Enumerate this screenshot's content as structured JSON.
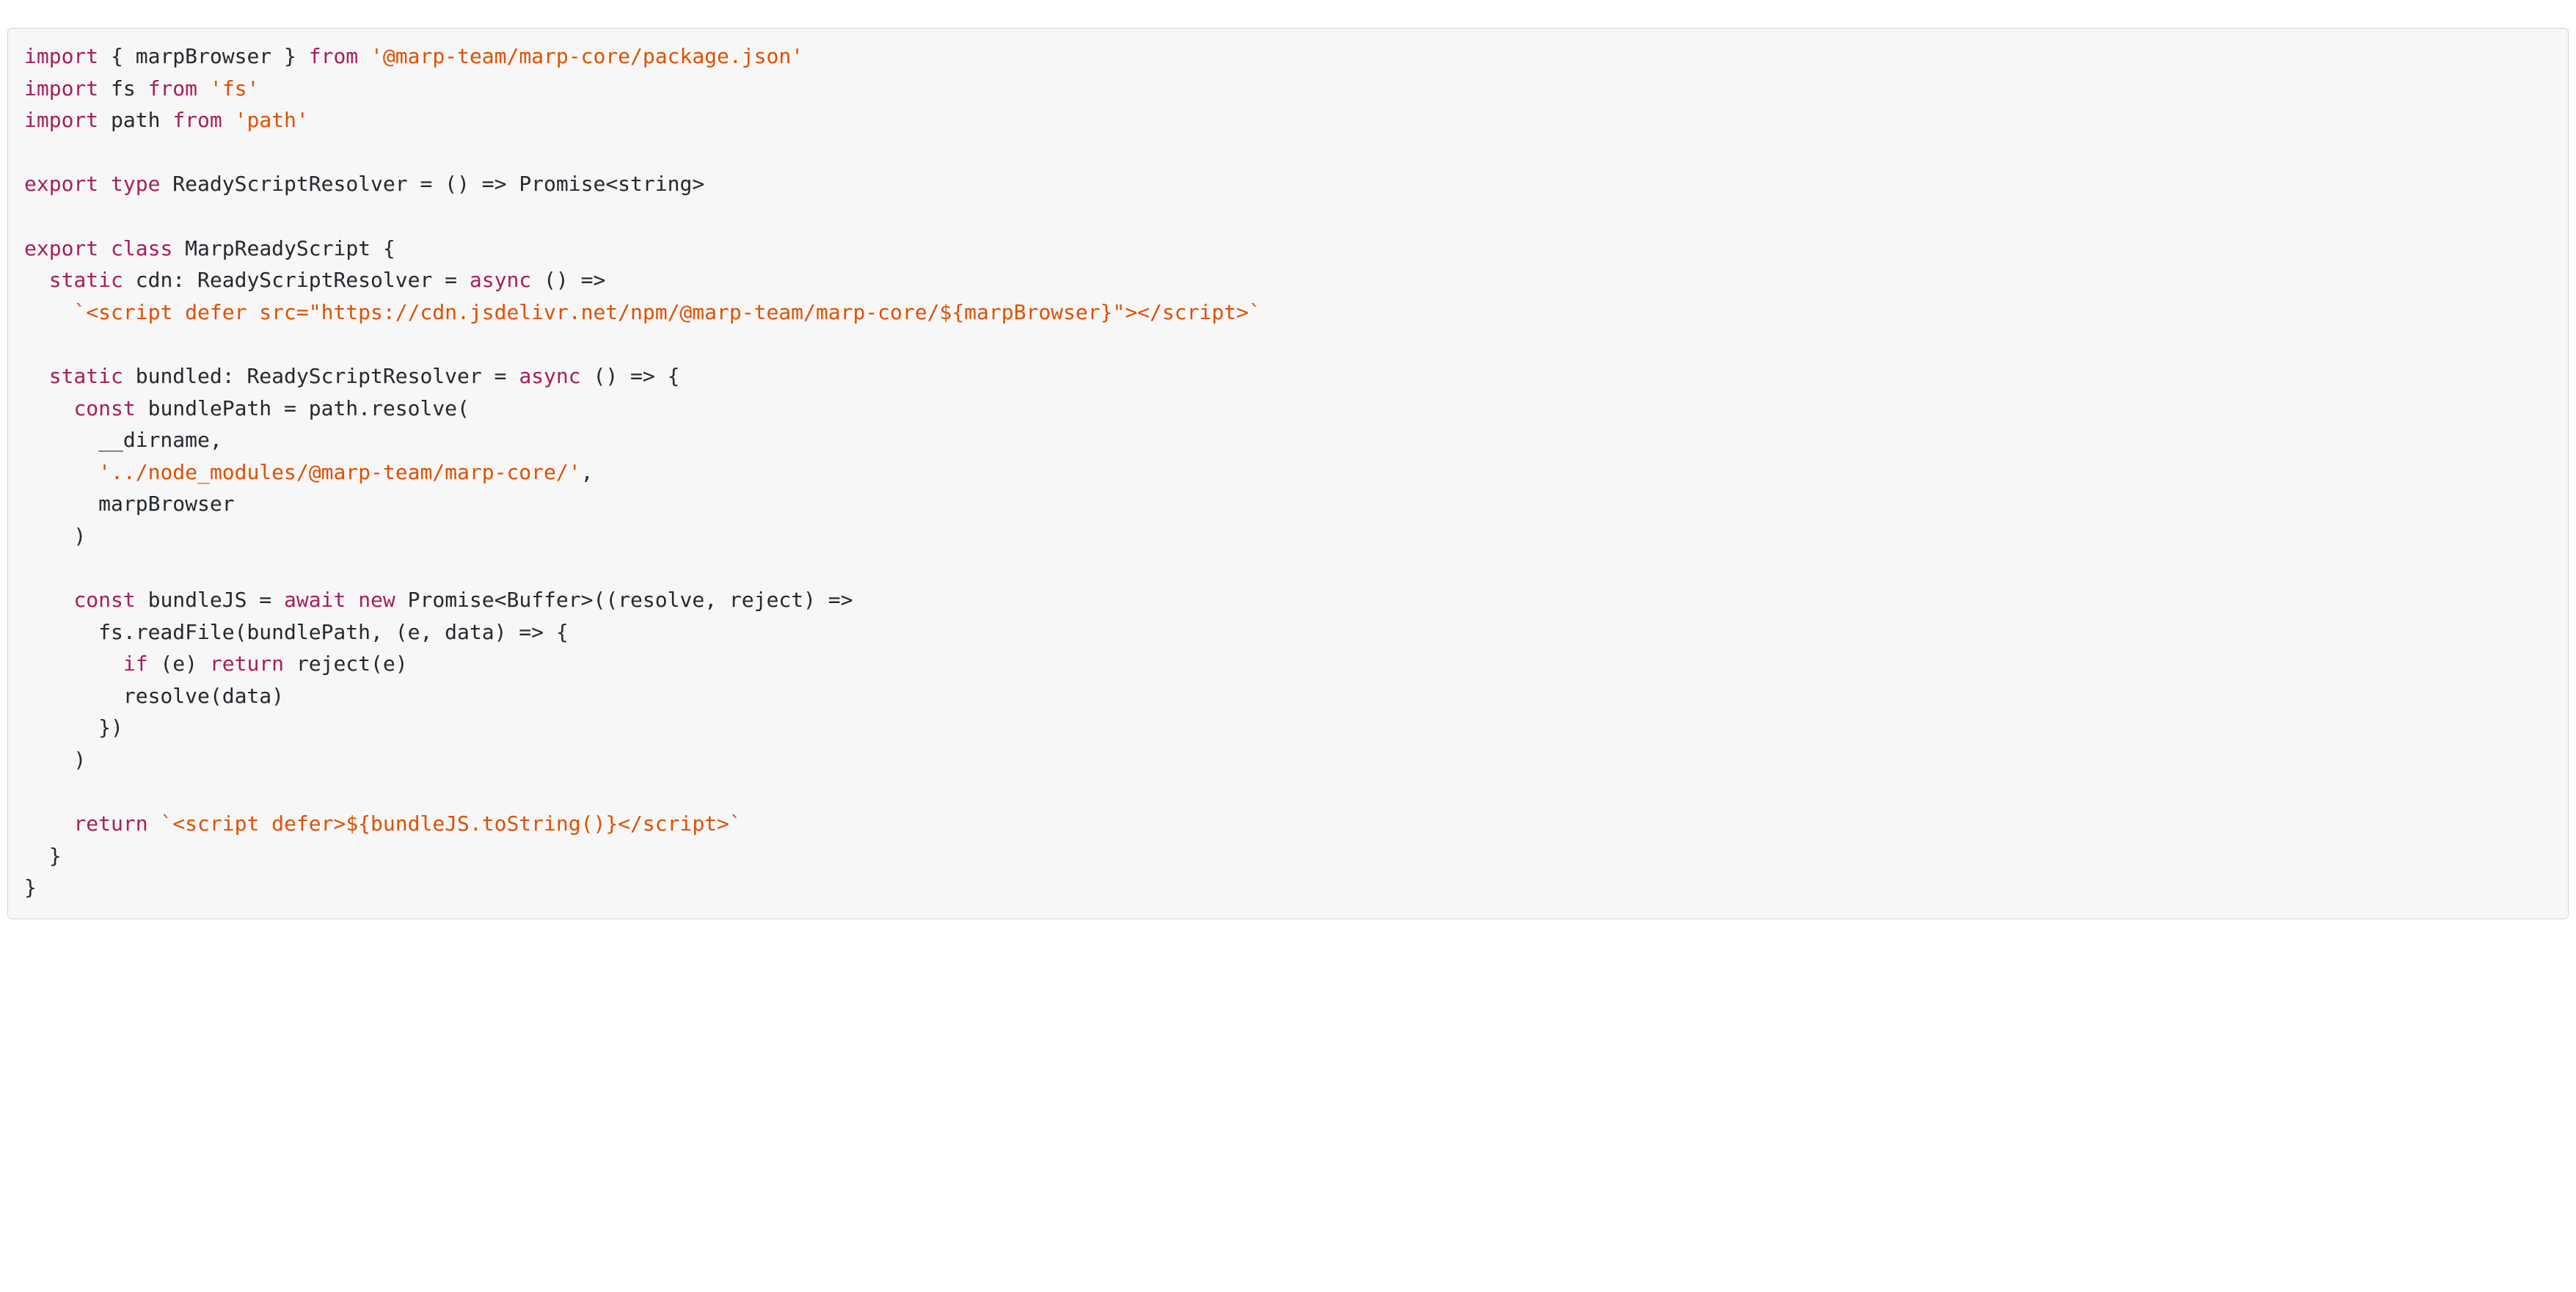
{
  "code": {
    "tokens": [
      [
        [
          "kw",
          "import"
        ],
        [
          "",
          " { marpBrowser } "
        ],
        [
          "kw",
          "from"
        ],
        [
          "",
          " "
        ],
        [
          "str",
          "'@marp-team/marp-core/package.json'"
        ]
      ],
      [
        [
          "kw",
          "import"
        ],
        [
          "",
          " fs "
        ],
        [
          "kw",
          "from"
        ],
        [
          "",
          " "
        ],
        [
          "str",
          "'fs'"
        ]
      ],
      [
        [
          "kw",
          "import"
        ],
        [
          "",
          " path "
        ],
        [
          "kw",
          "from"
        ],
        [
          "",
          " "
        ],
        [
          "str",
          "'path'"
        ]
      ],
      [
        [
          "",
          ""
        ]
      ],
      [
        [
          "kw",
          "export"
        ],
        [
          "",
          " "
        ],
        [
          "kw",
          "type"
        ],
        [
          "",
          " ReadyScriptResolver = () => Promise<string>"
        ]
      ],
      [
        [
          "",
          ""
        ]
      ],
      [
        [
          "kw",
          "export"
        ],
        [
          "",
          " "
        ],
        [
          "kw",
          "class"
        ],
        [
          "",
          " MarpReadyScript {"
        ]
      ],
      [
        [
          "",
          "  "
        ],
        [
          "kw",
          "static"
        ],
        [
          "",
          " cdn: ReadyScriptResolver = "
        ],
        [
          "kw",
          "async"
        ],
        [
          "",
          " () =>"
        ]
      ],
      [
        [
          "",
          "    "
        ],
        [
          "str",
          "`<script defer src=\"https://cdn.jsdelivr.net/npm/@marp-team/marp-core/${marpBrowser}\"></script>`"
        ]
      ],
      [
        [
          "",
          ""
        ]
      ],
      [
        [
          "",
          "  "
        ],
        [
          "kw",
          "static"
        ],
        [
          "",
          " bundled: ReadyScriptResolver = "
        ],
        [
          "kw",
          "async"
        ],
        [
          "",
          " () => {"
        ]
      ],
      [
        [
          "",
          "    "
        ],
        [
          "kw",
          "const"
        ],
        [
          "",
          " bundlePath = path.resolve("
        ]
      ],
      [
        [
          "",
          "      __dirname,"
        ]
      ],
      [
        [
          "",
          "      "
        ],
        [
          "str",
          "'../node_modules/@marp-team/marp-core/'"
        ],
        [
          "",
          ","
        ]
      ],
      [
        [
          "",
          "      marpBrowser"
        ]
      ],
      [
        [
          "",
          "    )"
        ]
      ],
      [
        [
          "",
          ""
        ]
      ],
      [
        [
          "",
          "    "
        ],
        [
          "kw",
          "const"
        ],
        [
          "",
          " bundleJS = "
        ],
        [
          "kw",
          "await"
        ],
        [
          "",
          " "
        ],
        [
          "kw",
          "new"
        ],
        [
          "",
          " Promise<Buffer>((resolve, reject) =>"
        ]
      ],
      [
        [
          "",
          "      fs.readFile(bundlePath, (e, data) => {"
        ]
      ],
      [
        [
          "",
          "        "
        ],
        [
          "kw",
          "if"
        ],
        [
          "",
          " (e) "
        ],
        [
          "kw",
          "return"
        ],
        [
          "",
          " reject(e)"
        ]
      ],
      [
        [
          "",
          "        resolve(data)"
        ]
      ],
      [
        [
          "",
          "      })"
        ]
      ],
      [
        [
          "",
          "    )"
        ]
      ],
      [
        [
          "",
          ""
        ]
      ],
      [
        [
          "",
          "    "
        ],
        [
          "kw",
          "return"
        ],
        [
          "",
          " "
        ],
        [
          "str",
          "`<script defer>${bundleJS.toString()}</script>`"
        ]
      ],
      [
        [
          "",
          "  }"
        ]
      ],
      [
        [
          "",
          "}"
        ]
      ]
    ]
  }
}
